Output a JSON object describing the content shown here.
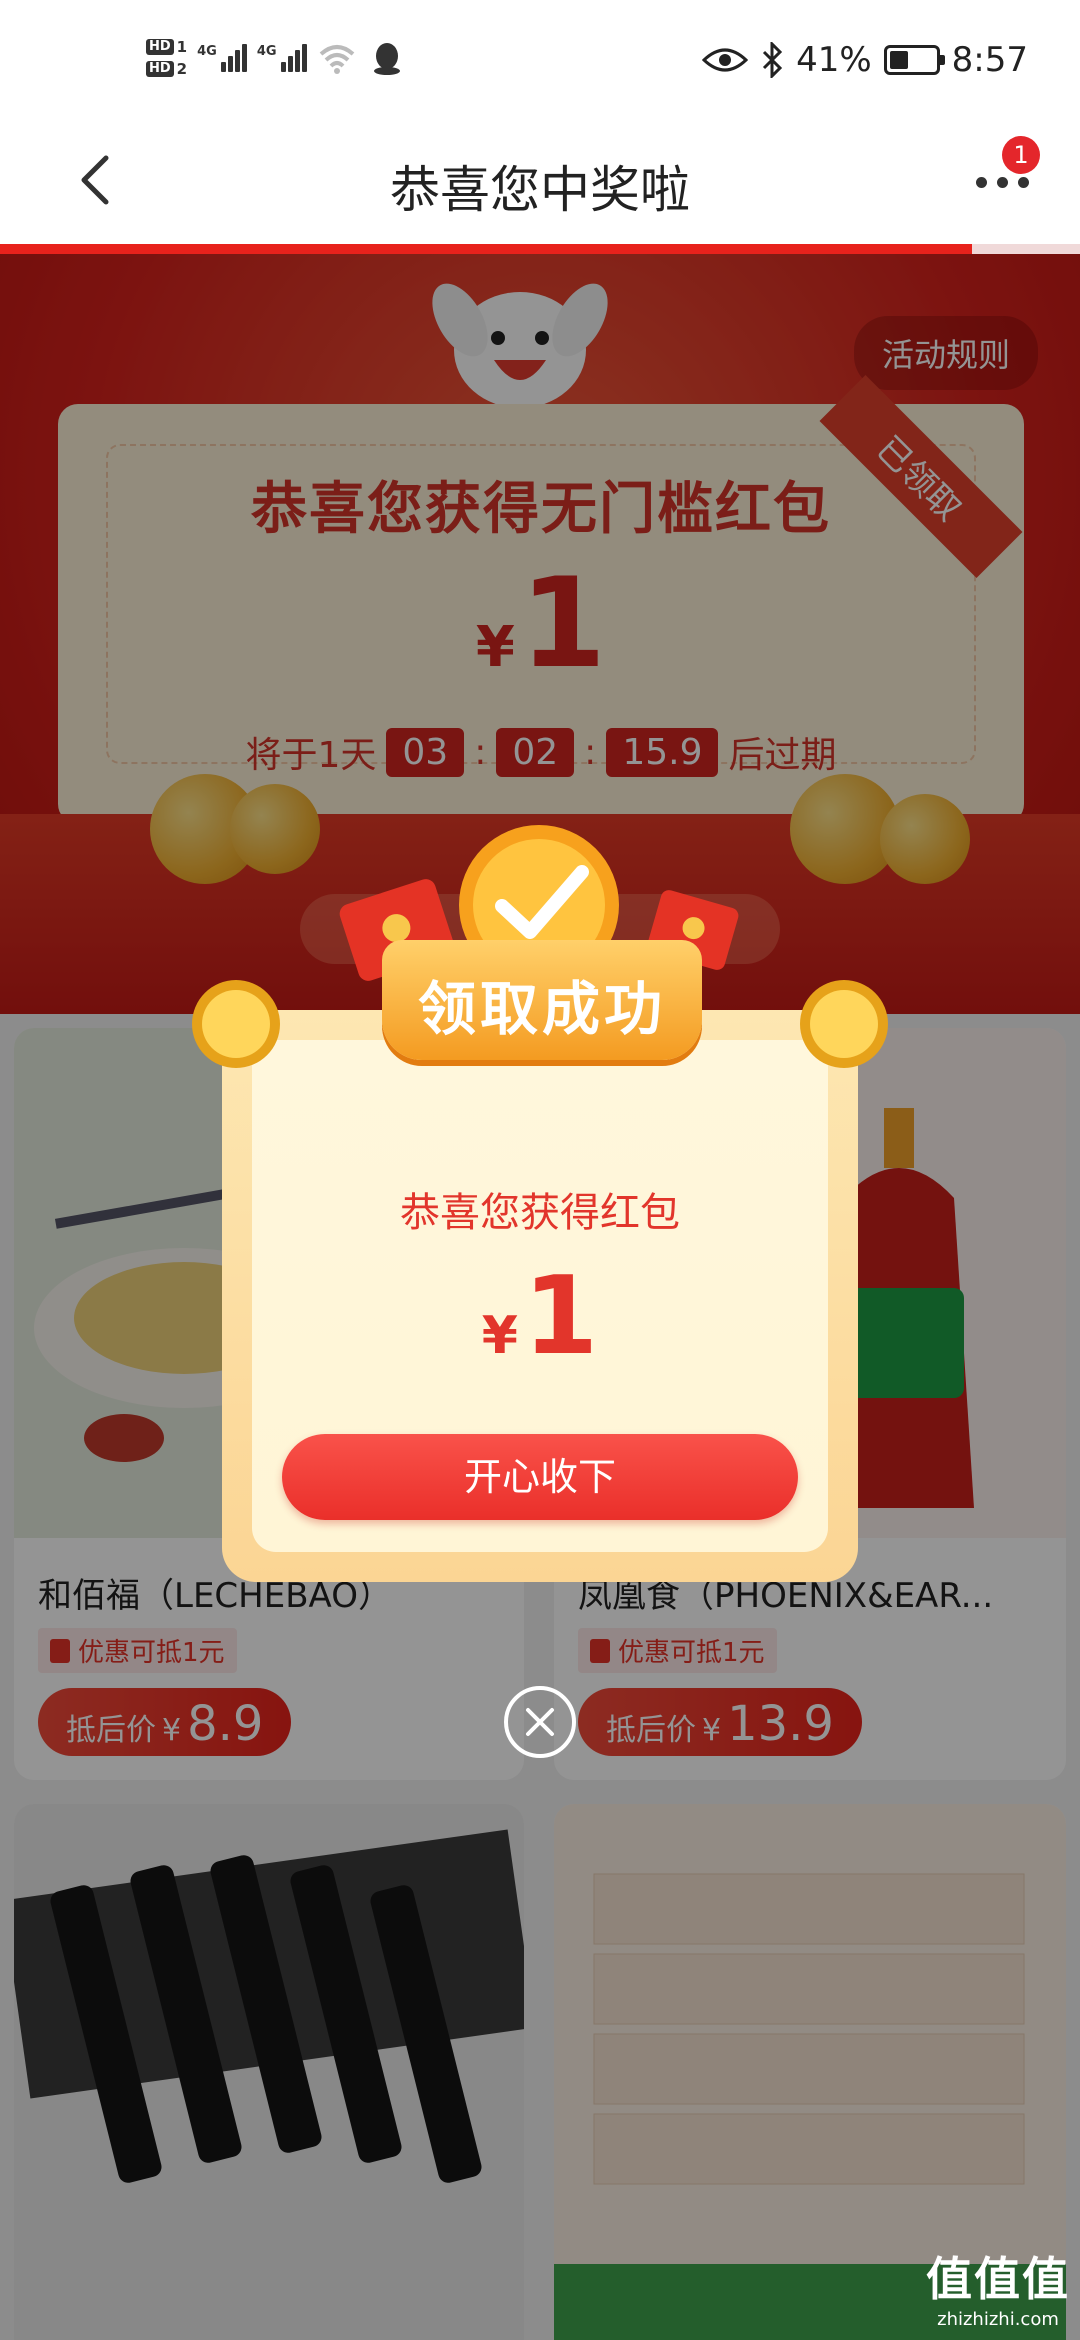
{
  "status_bar": {
    "hd1": "HD",
    "hd1_num": "1",
    "hd2": "HD",
    "hd2_num": "2",
    "net1": "4G",
    "net2": "4G",
    "battery_percent": "41%",
    "battery_level": 0.41,
    "time": "8:57"
  },
  "nav": {
    "title": "恭喜您中奖啦",
    "badge_count": "1",
    "page_progress": 0.9
  },
  "hero": {
    "rules_label": "活动规则",
    "ribbon_label": "已领取",
    "coupon_title": "恭喜您获得无门槛红包",
    "currency": "¥",
    "amount": "1",
    "expiry_prefix": "将于1天",
    "hours": "03",
    "minutes": "02",
    "seconds": "15.9",
    "sep": ":",
    "expiry_suffix": "后过期"
  },
  "products": [
    {
      "title": "和佰福（LECHEBAO）",
      "promo": "优惠可抵1元",
      "price_label": "抵后价",
      "currency": "¥",
      "price": "8.9"
    },
    {
      "title": "凤凰食（PHOENIX&EAR...",
      "promo": "优惠可抵1元",
      "price_label": "抵后价",
      "currency": "¥",
      "price": "13.9"
    }
  ],
  "popup": {
    "banner": "领取成功",
    "subtitle": "恭喜您获得红包",
    "currency": "¥",
    "amount": "1",
    "confirm_label": "开心收下"
  },
  "watermark": {
    "main": "值值值",
    "sub": "zhizhizhi.com"
  },
  "colors": {
    "accent_red": "#e8221c",
    "coupon_bg": "#fdf1d8",
    "popup_gold": "#fbd594"
  }
}
